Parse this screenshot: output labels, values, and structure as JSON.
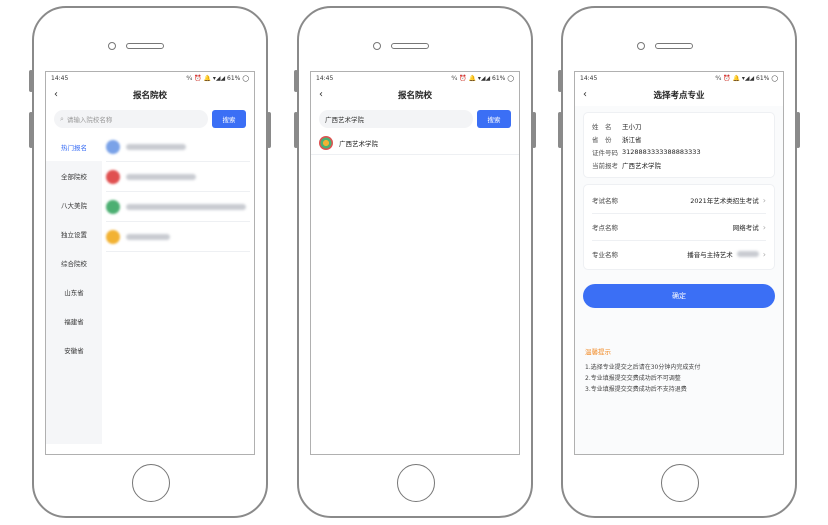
{
  "status": {
    "time": "14:45",
    "right": "⁶⁄₄ ⏰ 🔔 ▾◢◢ 61% ◯"
  },
  "screen1": {
    "title": "报名院校",
    "search_placeholder": "请输入院校名称",
    "search_button": "搜索",
    "sidebar": [
      "热门报名",
      "全部院校",
      "八大美院",
      "独立设置",
      "综合院校",
      "山东省",
      "福建省",
      "安徽省"
    ],
    "logo_colors": [
      "#7aa2e8",
      "#e05050",
      "#4caf72",
      "#f2b233"
    ]
  },
  "screen2": {
    "title": "报名院校",
    "search_value": "广西艺术学院",
    "search_button": "搜索",
    "result": "广西艺术学院"
  },
  "screen3": {
    "title": "选择考点专业",
    "info": [
      {
        "k": "姓　名",
        "v": "王小刀"
      },
      {
        "k": "省　份",
        "v": "浙江省"
      },
      {
        "k": "证件号码",
        "v": "3128883333388883333"
      },
      {
        "k": "当前报考",
        "v": "广西艺术学院"
      }
    ],
    "selects": [
      {
        "k": "考试名称",
        "v": "2021年艺术类招生考试"
      },
      {
        "k": "考点名称",
        "v": "网络考试"
      },
      {
        "k": "专业名称",
        "v": "播音与主持艺术"
      }
    ],
    "confirm": "确定",
    "tips_title": "温馨提示",
    "tips": [
      "1.选择专业提交之后请在30分钟内完成支付",
      "2.专业填报提交交费成功后不可调整",
      "3.专业填报提交交费成功后不支持退费"
    ]
  }
}
